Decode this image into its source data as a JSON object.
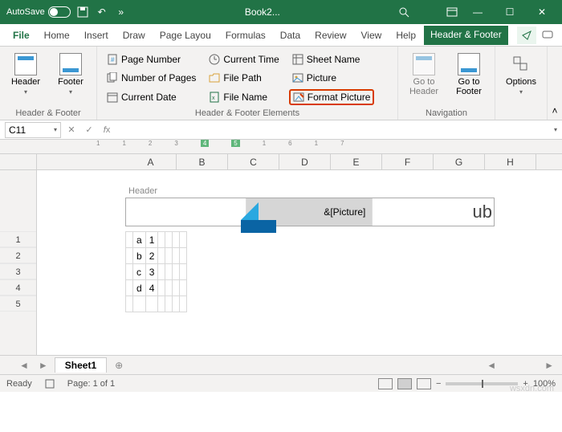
{
  "titlebar": {
    "autosave": "AutoSave",
    "filename": "Book2...",
    "search_placeholder": "Search"
  },
  "tabs": {
    "file": "File",
    "home": "Home",
    "insert": "Insert",
    "draw": "Draw",
    "pagelayout": "Page Layou",
    "formulas": "Formulas",
    "data": "Data",
    "review": "Review",
    "view": "View",
    "help": "Help",
    "headerfooter": "Header & Footer"
  },
  "ribbon": {
    "hf": {
      "group": "Header & Footer",
      "header": "Header",
      "footer": "Footer"
    },
    "elements": {
      "group": "Header & Footer Elements",
      "pagenumber": "Page Number",
      "numberofpages": "Number of Pages",
      "currentdate": "Current Date",
      "currenttime": "Current Time",
      "filepath": "File Path",
      "filename": "File Name",
      "sheetname": "Sheet Name",
      "picture": "Picture",
      "formatpicture": "Format Picture"
    },
    "nav": {
      "group": "Navigation",
      "gotoheader": "Go to Header",
      "gotofooter": "Go to Footer"
    },
    "options": {
      "options": "Options"
    }
  },
  "formula": {
    "cellref": "C11"
  },
  "columns": [
    "A",
    "B",
    "C",
    "D",
    "E",
    "F",
    "G",
    "H"
  ],
  "rows": [
    "1",
    "2",
    "3",
    "4",
    "5"
  ],
  "header_area": {
    "label": "Header",
    "center_value": "&[Picture]",
    "right_text": "ub"
  },
  "chart_data": {
    "type": "table",
    "columns": [
      "B",
      "C"
    ],
    "rows": [
      {
        "B": "a",
        "C": 1
      },
      {
        "B": "b",
        "C": 2
      },
      {
        "B": "c",
        "C": 3
      },
      {
        "B": "d",
        "C": 4
      }
    ]
  },
  "sheettabs": {
    "sheet1": "Sheet1"
  },
  "status": {
    "ready": "Ready",
    "page": "Page: 1 of 1",
    "zoom": "100%"
  },
  "watermark": "wsxdn.com"
}
